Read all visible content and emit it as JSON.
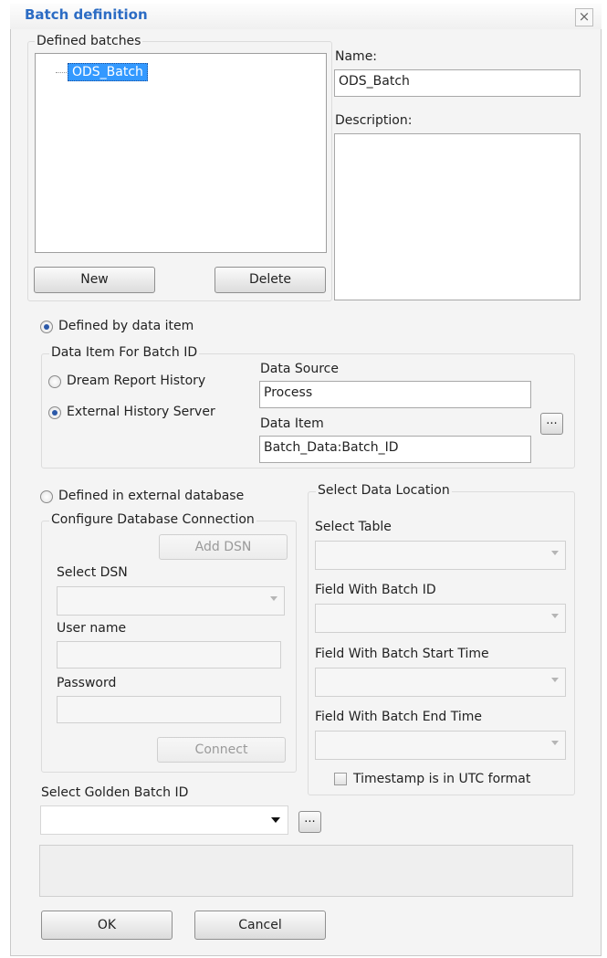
{
  "dialog": {
    "title": "Batch definition",
    "close_glyph": "×"
  },
  "batches": {
    "group_label": "Defined batches",
    "items": [
      "ODS_Batch"
    ],
    "new_label": "New",
    "delete_label": "Delete"
  },
  "name": {
    "label": "Name:",
    "value": "ODS_Batch"
  },
  "description": {
    "label": "Description:",
    "value": ""
  },
  "by_data_item": {
    "radio_label": "Defined by data item",
    "selected": true,
    "group_label": "Data Item For Batch ID",
    "options": [
      "Dream Report History",
      "External History Server"
    ],
    "selected_option": "External History Server",
    "data_source_label": "Data Source",
    "data_source_value": "Process",
    "data_item_label": "Data Item",
    "data_item_value": "Batch_Data:Batch_ID",
    "browse_label": "..."
  },
  "external_db": {
    "radio_label": "Defined in external database",
    "selected": false,
    "connection_group_label": "Configure Database Connection",
    "add_dsn_label": "Add DSN",
    "select_dsn_label": "Select DSN",
    "username_label": "User name",
    "password_label": "Password",
    "connect_label": "Connect",
    "location_group_label": "Select Data Location",
    "select_table_label": "Select Table",
    "field_batch_id_label": "Field With Batch ID",
    "field_start_label": "Field With Batch Start Time",
    "field_end_label": "Field With Batch End Time",
    "utc_label": "Timestamp is in UTC format",
    "utc_checked": false
  },
  "golden": {
    "label": "Select Golden Batch ID",
    "browse_label": "..."
  },
  "footer": {
    "ok_label": "OK",
    "cancel_label": "Cancel"
  }
}
